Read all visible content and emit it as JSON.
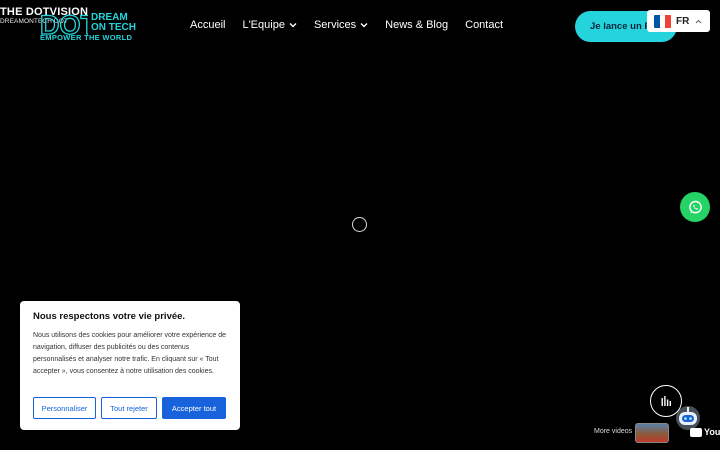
{
  "logo": {
    "title": "THE DOTVISION",
    "subtitle": "DREAMONTECH DOT",
    "mark": "DOT",
    "dream_line1": "DREAM",
    "dream_line2": "ON TECH",
    "tagline": "EMPOWER THE WORLD"
  },
  "nav": {
    "items": [
      {
        "label": "Accueil",
        "icon": null
      },
      {
        "label": "L'Equipe",
        "icon": "chevron-down-icon"
      },
      {
        "label": "Services",
        "icon": "chevron-down-icon"
      },
      {
        "label": "News & Blog",
        "icon": null
      },
      {
        "label": "Contact",
        "icon": null
      }
    ]
  },
  "cta": {
    "label": "Je lance un Pro"
  },
  "language": {
    "code": "FR",
    "flag_colors": [
      "#0055a4",
      "#ffffff",
      "#ef4135"
    ],
    "icon": "chevron-up-icon"
  },
  "cookie": {
    "title": "Nous respectons votre vie privée.",
    "text": "Nous utilisons des cookies pour améliorer votre expérience de navigation, diffuser des publicités ou des contenus personnalisés et analyser notre trafic. En cliquant sur « Tout accepter », vous consentez à notre utilisation des cookies.",
    "customize_label": "Personnaliser",
    "reject_label": "Tout rejeter",
    "accept_label": "Accepter tout"
  },
  "widgets": {
    "more_videos": "More videos",
    "youtube": "YouTu",
    "whatsapp_icon": "whatsapp-icon",
    "audio_icon": "audio-bars-icon",
    "chatbot_icon": "robot-icon"
  },
  "colors": {
    "accent": "#25d3dc",
    "whatsapp": "#25d366",
    "cookie_button": "#1863dc",
    "background": "#000000"
  }
}
